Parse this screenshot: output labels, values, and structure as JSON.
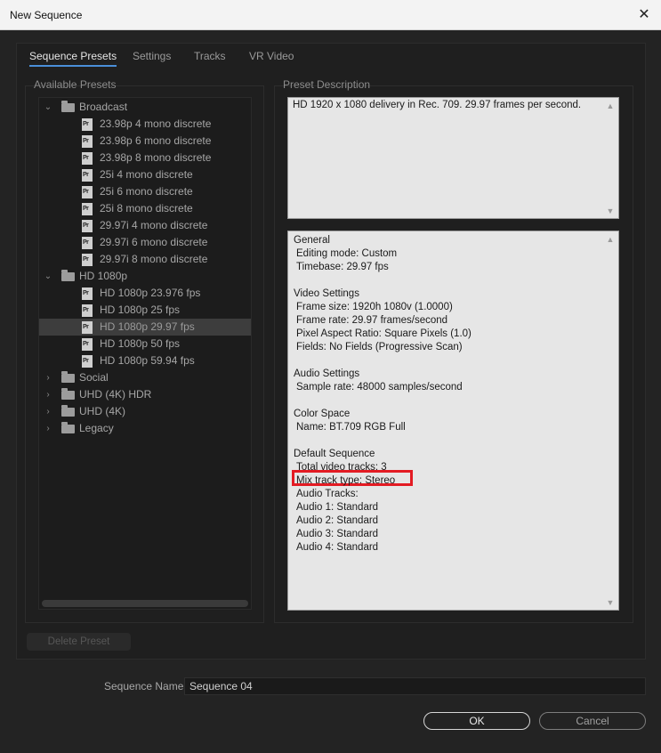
{
  "window": {
    "title": "New Sequence",
    "close_glyph": "✕"
  },
  "tabs": [
    {
      "label": "Sequence Presets",
      "active": true
    },
    {
      "label": "Settings"
    },
    {
      "label": "Tracks"
    },
    {
      "label": "VR Video"
    }
  ],
  "left": {
    "label": "Available Presets",
    "tree": [
      {
        "type": "folder",
        "label": "Broadcast",
        "expanded": true
      },
      {
        "type": "file",
        "label": "23.98p 4 mono discrete"
      },
      {
        "type": "file",
        "label": "23.98p 6 mono discrete"
      },
      {
        "type": "file",
        "label": "23.98p 8 mono discrete"
      },
      {
        "type": "file",
        "label": "25i 4 mono discrete"
      },
      {
        "type": "file",
        "label": "25i 6 mono discrete"
      },
      {
        "type": "file",
        "label": "25i 8 mono discrete"
      },
      {
        "type": "file",
        "label": "29.97i 4 mono discrete"
      },
      {
        "type": "file",
        "label": "29.97i 6 mono discrete"
      },
      {
        "type": "file",
        "label": "29.97i 8 mono discrete"
      },
      {
        "type": "folder",
        "label": "HD 1080p",
        "expanded": true
      },
      {
        "type": "file",
        "label": "HD 1080p 23.976 fps"
      },
      {
        "type": "file",
        "label": "HD 1080p 25 fps"
      },
      {
        "type": "file",
        "label": "HD 1080p 29.97 fps",
        "selected": true
      },
      {
        "type": "file",
        "label": "HD 1080p 50 fps"
      },
      {
        "type": "file",
        "label": "HD 1080p 59.94 fps"
      },
      {
        "type": "folder",
        "label": "Social",
        "expanded": false
      },
      {
        "type": "folder",
        "label": "UHD (4K) HDR",
        "expanded": false
      },
      {
        "type": "folder",
        "label": "UHD (4K)",
        "expanded": false
      },
      {
        "type": "folder",
        "label": "Legacy",
        "expanded": false
      }
    ],
    "file_icon_text": "Pr",
    "delete_button": "Delete Preset"
  },
  "right": {
    "label": "Preset Description",
    "description": "HD 1920 x 1080 delivery in Rec. 709. 29.97 frames per second.",
    "info_lines": [
      {
        "text": "General",
        "indent": false
      },
      {
        "text": "Editing mode: Custom",
        "indent": true
      },
      {
        "text": "Timebase: 29.97 fps",
        "indent": true
      },
      {
        "text": "",
        "indent": false
      },
      {
        "text": "Video Settings",
        "indent": false
      },
      {
        "text": "Frame size: 1920h 1080v (1.0000)",
        "indent": true
      },
      {
        "text": "Frame rate: 29.97  frames/second",
        "indent": true
      },
      {
        "text": "Pixel Aspect Ratio: Square Pixels (1.0)",
        "indent": true
      },
      {
        "text": "Fields: No Fields (Progressive Scan)",
        "indent": true
      },
      {
        "text": "",
        "indent": false
      },
      {
        "text": "Audio Settings",
        "indent": false
      },
      {
        "text": "Sample rate: 48000 samples/second",
        "indent": true
      },
      {
        "text": "",
        "indent": false
      },
      {
        "text": "Color Space",
        "indent": false
      },
      {
        "text": "Name: BT.709 RGB Full",
        "indent": true
      },
      {
        "text": "",
        "indent": false
      },
      {
        "text": "Default Sequence",
        "indent": false
      },
      {
        "text": "Total video tracks: 3",
        "indent": true
      },
      {
        "text": "Mix track type: Stereo",
        "indent": true
      },
      {
        "text": "Audio Tracks:",
        "indent": true
      },
      {
        "text": "Audio 1: Standard",
        "indent": true
      },
      {
        "text": "Audio 2: Standard",
        "indent": true
      },
      {
        "text": "Audio 3: Standard",
        "indent": true
      },
      {
        "text": "Audio 4: Standard",
        "indent": true
      }
    ]
  },
  "sequence_name": {
    "label": "Sequence Name:",
    "value": "Sequence 04"
  },
  "buttons": {
    "ok": "OK",
    "cancel": "Cancel"
  },
  "colors": {
    "accent": "#4a8fd9",
    "highlight": "#e31b23"
  }
}
